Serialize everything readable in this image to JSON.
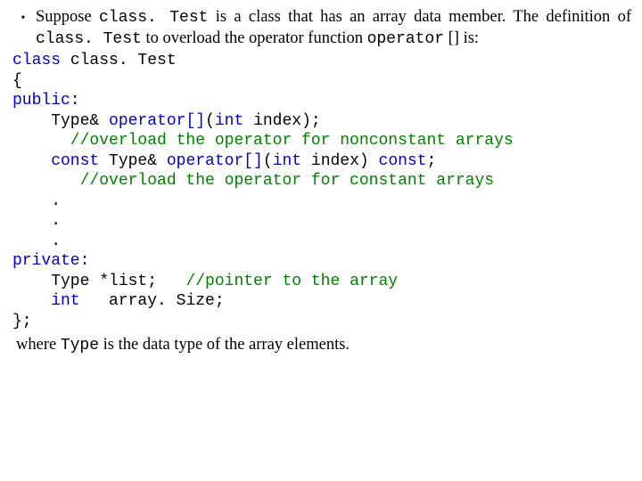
{
  "bullet": {
    "glyph": "•",
    "seg1": "Suppose ",
    "seg2": "class. Test",
    "seg3": " is a class that has an array data member. The definition of ",
    "seg4": "class. Test",
    "seg5": " to overload the operator function ",
    "seg6": "operator",
    "seg7": " [] is:"
  },
  "code": {
    "l1a": "class",
    "l1b": " class. Test",
    "l2": "{",
    "l3": "public:",
    "l4a": "    Type& ",
    "l4b": "operator[]",
    "l4c": "(",
    "l4d": "int",
    "l4e": " index);",
    "l5": "      //overload the operator for nonconstant arrays",
    "l6a": "    const",
    "l6b": " Type& ",
    "l6c": "operator[]",
    "l6d": "(",
    "l6e": "int",
    "l6f": " index) ",
    "l6g": "const",
    "l6h": ";",
    "l7": "       //overload the operator for constant arrays",
    "l8": "    .",
    "l9": "    .",
    "l10": "    .",
    "l11": "private:",
    "l12a": "    Type *list;   ",
    "l12b": "//pointer to the array",
    "l13a": "    int",
    "l13b": "   array. Size;",
    "l14": "};"
  },
  "footer": {
    "seg1": "where ",
    "seg2": "Type",
    "seg3": " is the data type of the array elements."
  }
}
